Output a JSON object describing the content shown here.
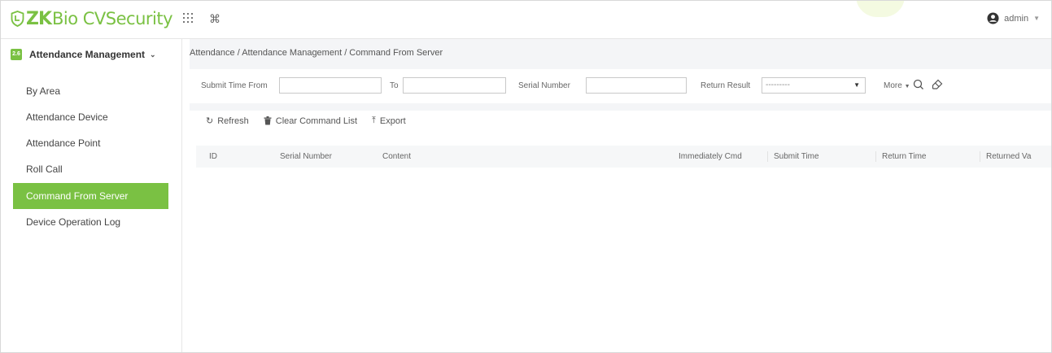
{
  "app": {
    "logo_zk": "ZK",
    "logo_rest": "Bio CVSecurity",
    "user": "admin",
    "accent": "#7ac143"
  },
  "topbar": {
    "icons": [
      "apps-grid-icon",
      "command-key-icon"
    ]
  },
  "sidebar": {
    "module": "Attendance Management",
    "module_icon_text": "2.6",
    "items": [
      {
        "label": "By Area",
        "active": false
      },
      {
        "label": "Attendance Device",
        "active": false
      },
      {
        "label": "Attendance Point",
        "active": false
      },
      {
        "label": "Roll Call",
        "active": false
      },
      {
        "label": "Command From Server",
        "active": true
      },
      {
        "label": "Device Operation Log",
        "active": false
      }
    ]
  },
  "breadcrumb": "Attendance / Attendance Management / Command From Server",
  "filters": {
    "submit_time_from_label": "Submit Time From",
    "submit_time_from_value": "",
    "to_label": "To",
    "to_value": "",
    "serial_number_label": "Serial Number",
    "serial_number_value": "",
    "return_result_label": "Return Result",
    "return_result_value": "---------",
    "more_label": "More"
  },
  "toolbar": {
    "refresh": "Refresh",
    "clear": "Clear Command List",
    "export": "Export"
  },
  "table": {
    "columns": [
      "ID",
      "Serial Number",
      "Content",
      "Immediately Cmd",
      "Submit Time",
      "Return Time",
      "Returned Va"
    ],
    "rows": []
  }
}
